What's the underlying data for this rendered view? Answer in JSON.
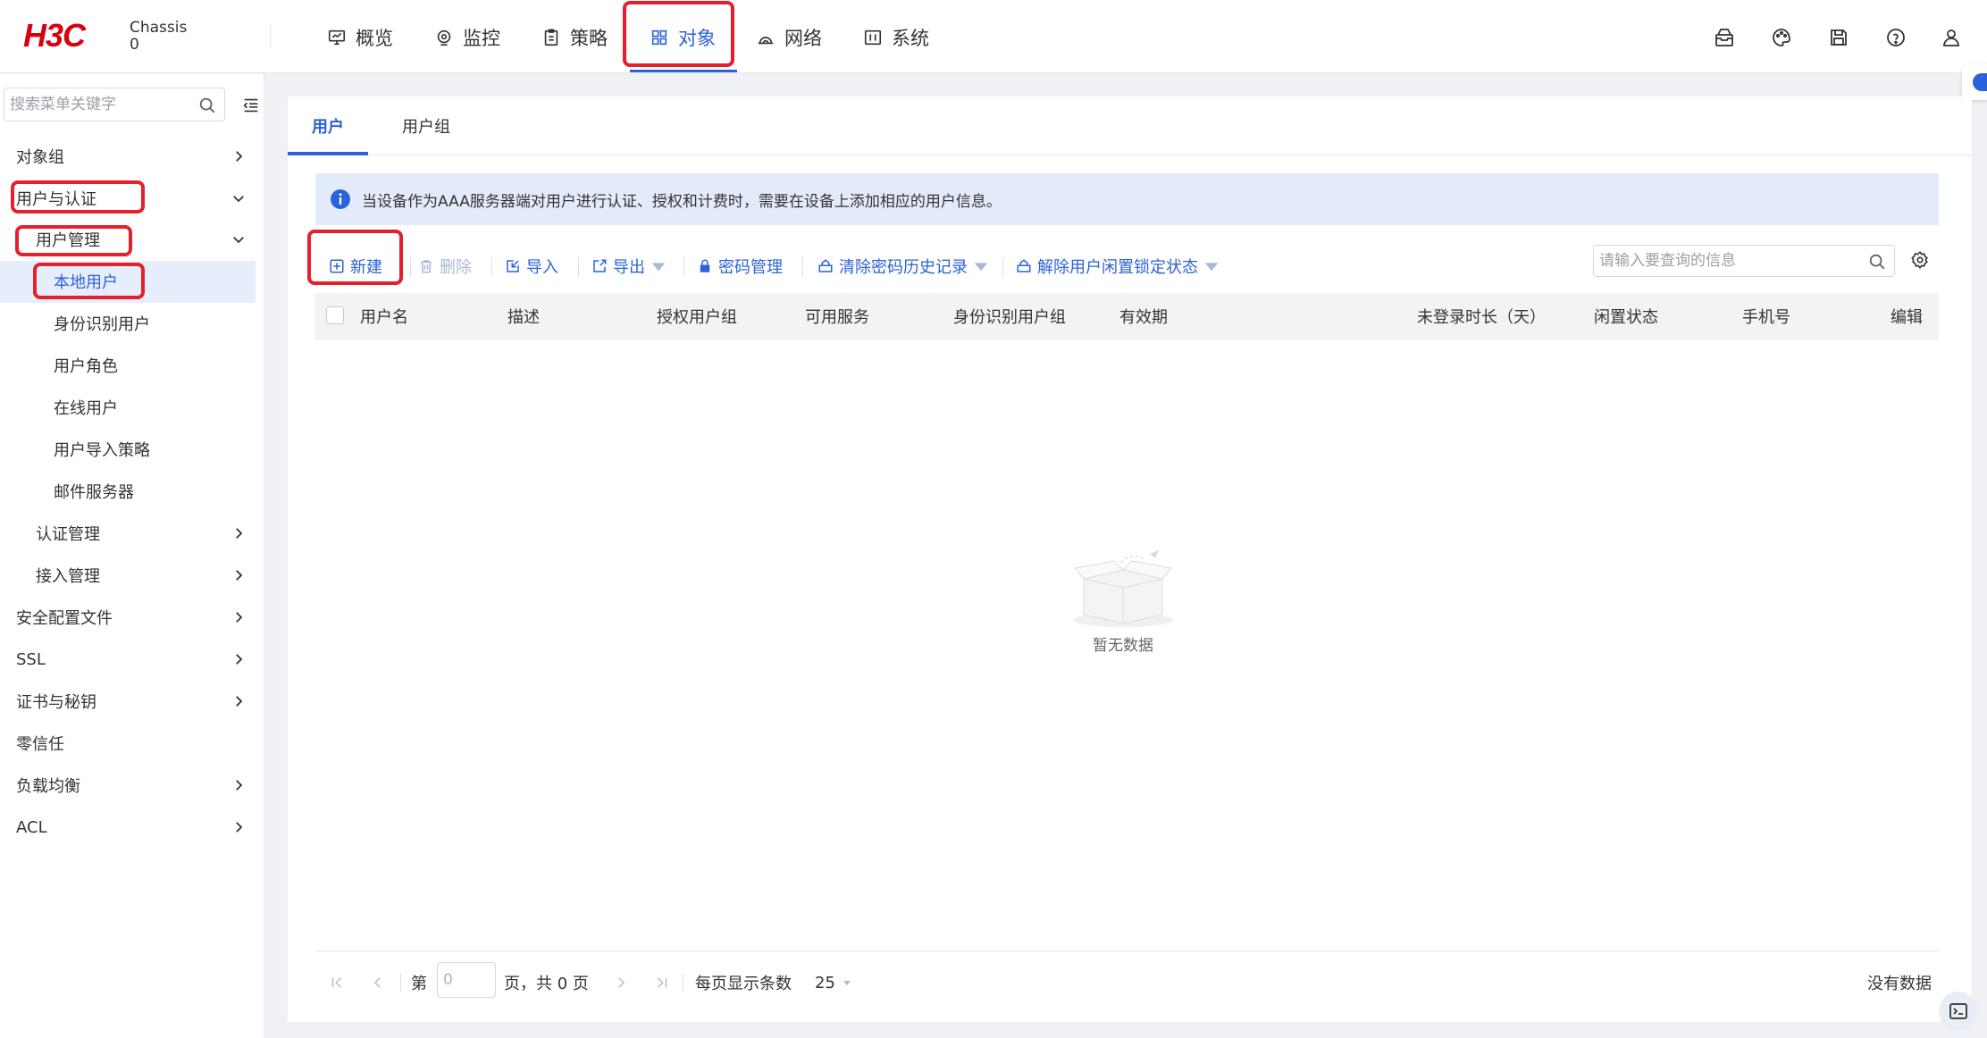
{
  "header": {
    "logo_text": "H3C",
    "chassis_line1": "Chassis",
    "chassis_line2": "0",
    "nav": [
      {
        "label": "概览",
        "icon": "dashboard-icon"
      },
      {
        "label": "监控",
        "icon": "monitor-icon"
      },
      {
        "label": "策略",
        "icon": "policy-icon"
      },
      {
        "label": "对象",
        "icon": "object-grid-icon",
        "active": true
      },
      {
        "label": "网络",
        "icon": "network-icon"
      },
      {
        "label": "系统",
        "icon": "system-icon"
      }
    ],
    "right_icons": [
      "message-box-icon",
      "palette-icon",
      "save-icon",
      "help-icon",
      "user-icon"
    ]
  },
  "sidebar": {
    "search_placeholder": "搜索菜单关键字",
    "items": [
      {
        "label": "对象组",
        "level": 1,
        "chevron": "right"
      },
      {
        "label": "用户与认证",
        "level": 1,
        "chevron": "down"
      },
      {
        "label": "用户管理",
        "level": 2,
        "chevron": "down"
      },
      {
        "label": "本地用户",
        "level": 3,
        "selected": true
      },
      {
        "label": "身份识别用户",
        "level": 3
      },
      {
        "label": "用户角色",
        "level": 3
      },
      {
        "label": "在线用户",
        "level": 3
      },
      {
        "label": "用户导入策略",
        "level": 3
      },
      {
        "label": "邮件服务器",
        "level": 3
      },
      {
        "label": "认证管理",
        "level": 2,
        "chevron": "right"
      },
      {
        "label": "接入管理",
        "level": 2,
        "chevron": "right"
      },
      {
        "label": "安全配置文件",
        "level": 1,
        "chevron": "right"
      },
      {
        "label": "SSL",
        "level": 1,
        "chevron": "right"
      },
      {
        "label": "证书与秘钥",
        "level": 1,
        "chevron": "right"
      },
      {
        "label": "零信任",
        "level": 1
      },
      {
        "label": "负载均衡",
        "level": 1,
        "chevron": "right"
      },
      {
        "label": "ACL",
        "level": 1,
        "chevron": "right"
      }
    ]
  },
  "main": {
    "tabs": [
      {
        "label": "用户",
        "active": true
      },
      {
        "label": "用户组"
      }
    ],
    "info_text": "当设备作为AAA服务器端对用户进行认证、授权和计费时，需要在设备上添加相应的用户信息。",
    "toolbar": {
      "new_label": "新建",
      "delete_label": "删除",
      "import_label": "导入",
      "export_label": "导出",
      "password_mgmt_label": "密码管理",
      "clear_pwd_history_label": "清除密码历史记录",
      "unlock_idle_label": "解除用户闲置锁定状态",
      "query_placeholder": "请输入要查询的信息"
    },
    "table": {
      "columns": [
        "用户名",
        "描述",
        "授权用户组",
        "可用服务",
        "身份识别用户组",
        "有效期",
        "未登录时长（天）",
        "闲置状态",
        "手机号",
        "编辑"
      ],
      "rows": [],
      "empty_text": "暂无数据"
    },
    "pagination": {
      "page_prefix": "第",
      "page_input_placeholder": "0",
      "page_suffix": "页，共 0 页",
      "per_page_label": "每页显示条数",
      "per_page_value": "25",
      "status_text": "没有数据"
    }
  },
  "colors": {
    "accent": "#2b62d9",
    "highlight_box": "#e4202d",
    "info_bg": "#e3ebfb",
    "brand_red": "#d7000f"
  }
}
